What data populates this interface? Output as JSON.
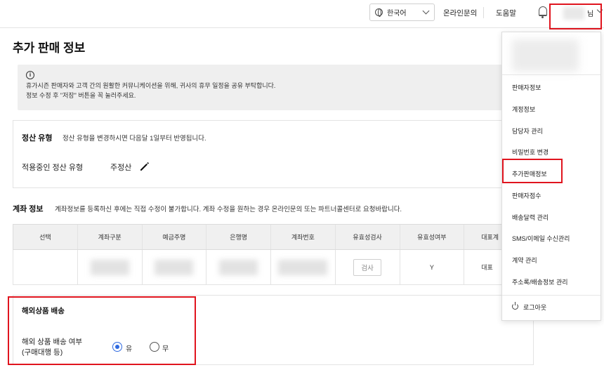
{
  "topbar": {
    "language": "한국어",
    "inquiry": "온라인문의",
    "help": "도움말",
    "user_suffix": "님"
  },
  "page": {
    "title": "추가 판매 정보"
  },
  "notice": {
    "icon": "i",
    "line1": "휴가시즌 판매자와 고객 간의 원활한 커뮤니케이션을 위해, 귀사의 휴무 일정을 공유 부탁합니다.",
    "line2": "정보 수정 후 \"저장\" 버튼을 꼭 눌러주세요."
  },
  "settlement": {
    "title": "정산 유형",
    "desc": "정산 유형을 변경하시면 다음달 1일부터 반영됩니다.",
    "label": "적용중인 정산 유형",
    "value": "주정산"
  },
  "account": {
    "title": "계좌 정보",
    "desc": "계좌정보를 등록하신 후에는 직접 수정이 불가합니다. 계좌 수정을 원하는 경우 온라인문의 또는 파트너콜센터로 요청바랍니다.",
    "columns": [
      "선택",
      "계좌구분",
      "예금주명",
      "은행명",
      "계좌번호",
      "유효성검사",
      "유효성여부",
      "대표계"
    ],
    "row": {
      "verify_button": "검사",
      "valid": "Y",
      "representative": "대표"
    }
  },
  "overseas": {
    "title": "해외상품 배송",
    "label_line1": "해외 상품 배송 여부",
    "label_line2": "(구매대행 등)",
    "option_yes": "유",
    "option_no": "무",
    "selected": "유"
  },
  "menu": {
    "items": [
      "판매자정보",
      "계정정보",
      "담당자 관리",
      "비밀번호 변경",
      "추가판매정보",
      "판매자점수",
      "배송달력 관리",
      "SMS/이메일 수신관리",
      "계약 관리",
      "주소록/배송정보 관리"
    ],
    "highlighted": "추가판매정보",
    "logout": "로그아웃"
  },
  "colors": {
    "highlight_border": "#e0141e",
    "radio_selected": "#2f6ae0",
    "notice_bg": "#efefef"
  }
}
